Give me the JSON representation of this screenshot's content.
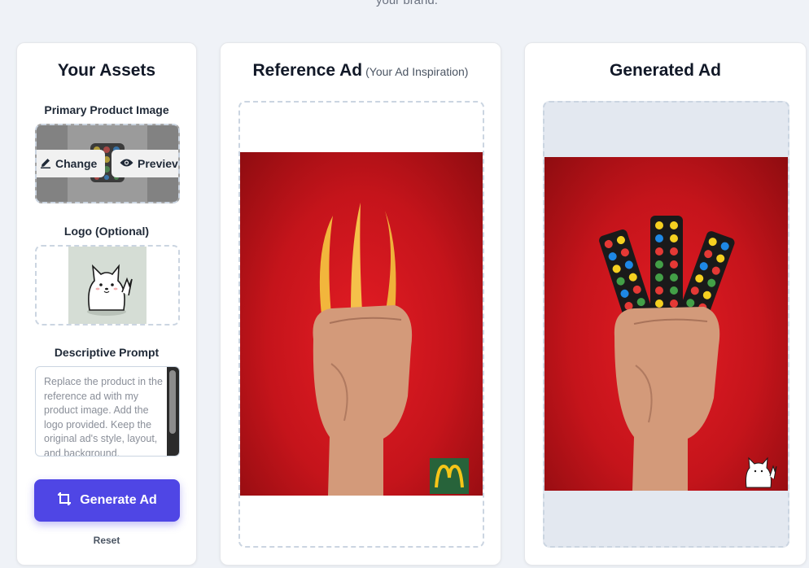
{
  "header": {
    "subtitle_tail": "your brand."
  },
  "assets": {
    "title": "Your Assets",
    "product_label": "Primary Product Image",
    "change_label": "Change",
    "preview_label": "Previev",
    "logo_label": "Logo (Optional)",
    "prompt_label": "Descriptive Prompt",
    "prompt_placeholder": "Replace the product in the reference ad with my product image. Add the logo provided. Keep the original ad's style, layout, and background.",
    "generate_label": "Generate Ad",
    "reset_label": "Reset"
  },
  "reference": {
    "title": "Reference Ad",
    "hint": "(Your Ad Inspiration)"
  },
  "generated": {
    "title": "Generated Ad"
  },
  "icons": [
    "edit-icon",
    "eye-icon",
    "crop-sparkle-icon"
  ],
  "colors": {
    "accent": "#4f46e5",
    "ad_red": "#e41c24",
    "background": "#eff2f7"
  }
}
